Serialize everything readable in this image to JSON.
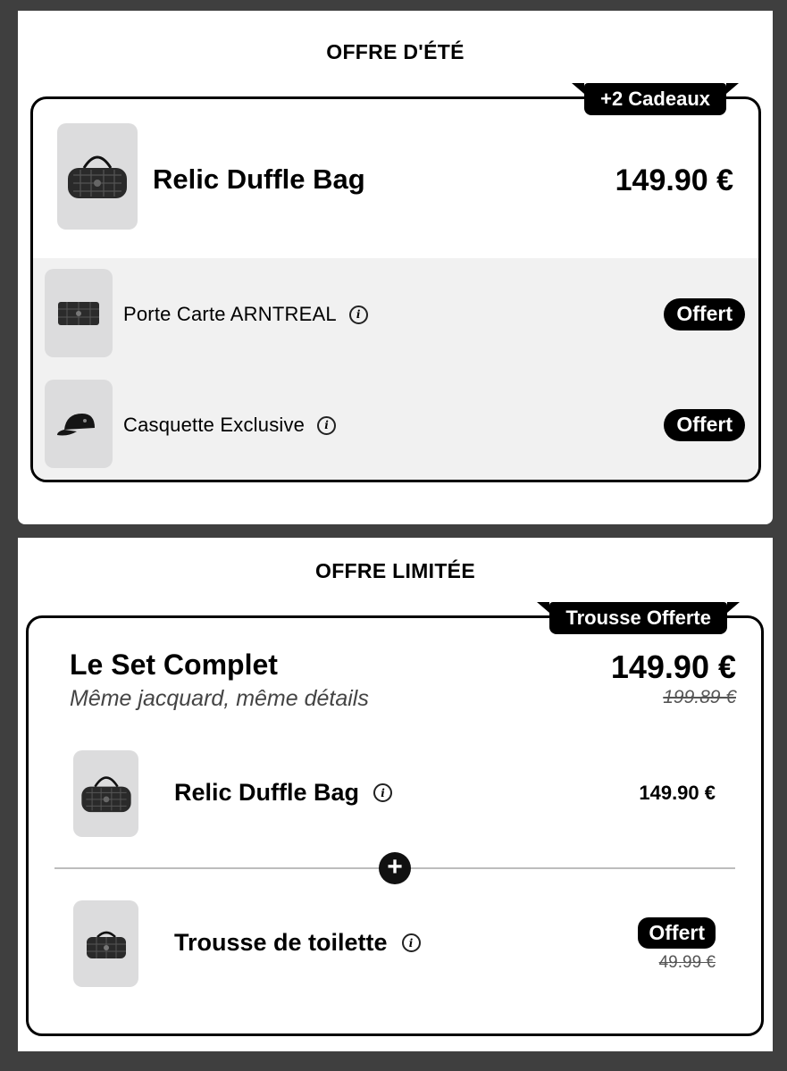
{
  "offer1": {
    "section_title": "OFFRE D'ÉTÉ",
    "ribbon": "+2 Cadeaux",
    "main_product": {
      "name": "Relic Duffle Bag",
      "price": "149.90 €"
    },
    "gifts": [
      {
        "name": "Porte Carte ARNTREAL",
        "badge": "Offert"
      },
      {
        "name": "Casquette Exclusive",
        "badge": "Offert"
      }
    ]
  },
  "offer2": {
    "section_title": "OFFRE LIMITÉE",
    "ribbon": "Trousse Offerte",
    "title": "Le Set Complet",
    "subtitle": "Même jacquard, même détails",
    "price": "149.90 €",
    "old_price": "199.89 €",
    "items": [
      {
        "name": "Relic Duffle Bag",
        "price": "149.90 €"
      },
      {
        "name": "Trousse de toilette",
        "badge": "Offert",
        "old_price": "49.99 €"
      }
    ],
    "plus_symbol": "+"
  },
  "icons": {
    "info": "i"
  }
}
